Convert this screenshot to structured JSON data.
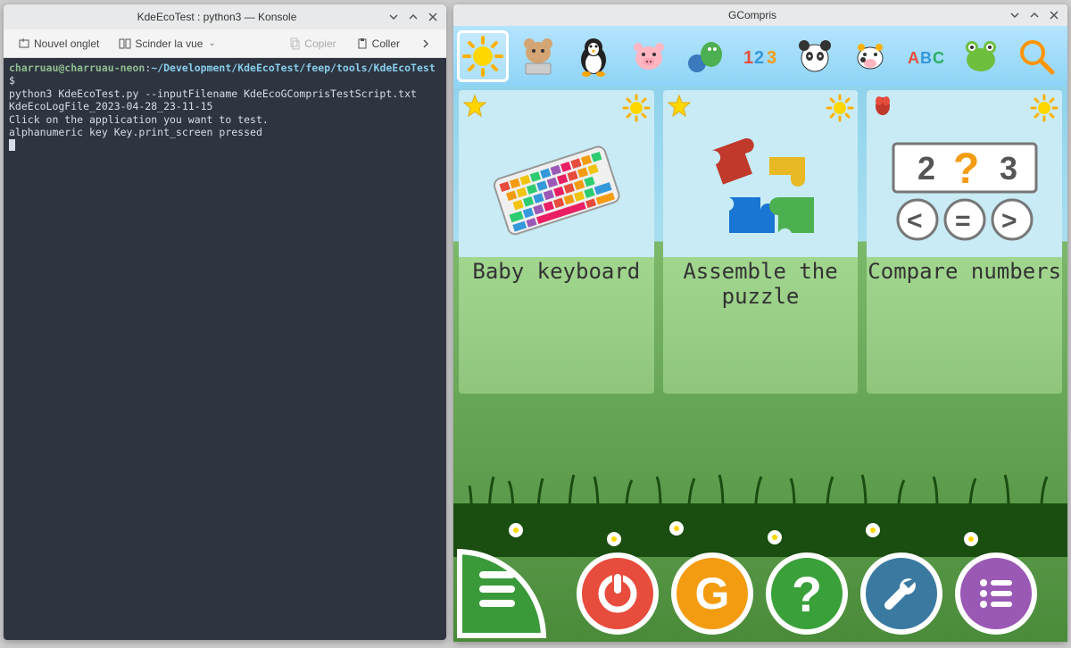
{
  "terminal": {
    "title": "KdeEcoTest : python3 — Konsole",
    "toolbar": {
      "new_tab": "Nouvel onglet",
      "split": "Scinder la vue",
      "copy": "Copier",
      "paste": "Coller"
    },
    "prompt_user": "charruau@charruau-neon",
    "prompt_path": "~/Development/KdeEcoTest/feep/tools/KdeEcoTest",
    "prompt_dollar": "$",
    "cmd": "python3 KdeEcoTest.py --inputFilename KdeEcoGComprisTestScript.txt",
    "line2": "KdeEcoLogFile_2023-04-28_23-11-15",
    "line3": "Click on the application you want to test.",
    "line4": "alphanumeric key Key.print_screen pressed"
  },
  "gcompris": {
    "title": "GCompris",
    "categories": [
      {
        "name": "sun",
        "selected": true
      },
      {
        "name": "mouse"
      },
      {
        "name": "penguin"
      },
      {
        "name": "pig"
      },
      {
        "name": "ball-dragon"
      },
      {
        "name": "123"
      },
      {
        "name": "panda"
      },
      {
        "name": "cow"
      },
      {
        "name": "abc"
      },
      {
        "name": "frog"
      },
      {
        "name": "search"
      }
    ],
    "activities": [
      {
        "badge": "star",
        "title": "Baby keyboard",
        "icon": "keyboard"
      },
      {
        "badge": "star",
        "title": "Assemble the puzzle",
        "icon": "puzzle"
      },
      {
        "badge": "bug",
        "title": "Compare numbers",
        "icon": "compare"
      }
    ],
    "controls": {
      "menu": "menu",
      "quit": "quit",
      "about": "G",
      "help": "?",
      "settings": "settings",
      "list": "list"
    }
  }
}
